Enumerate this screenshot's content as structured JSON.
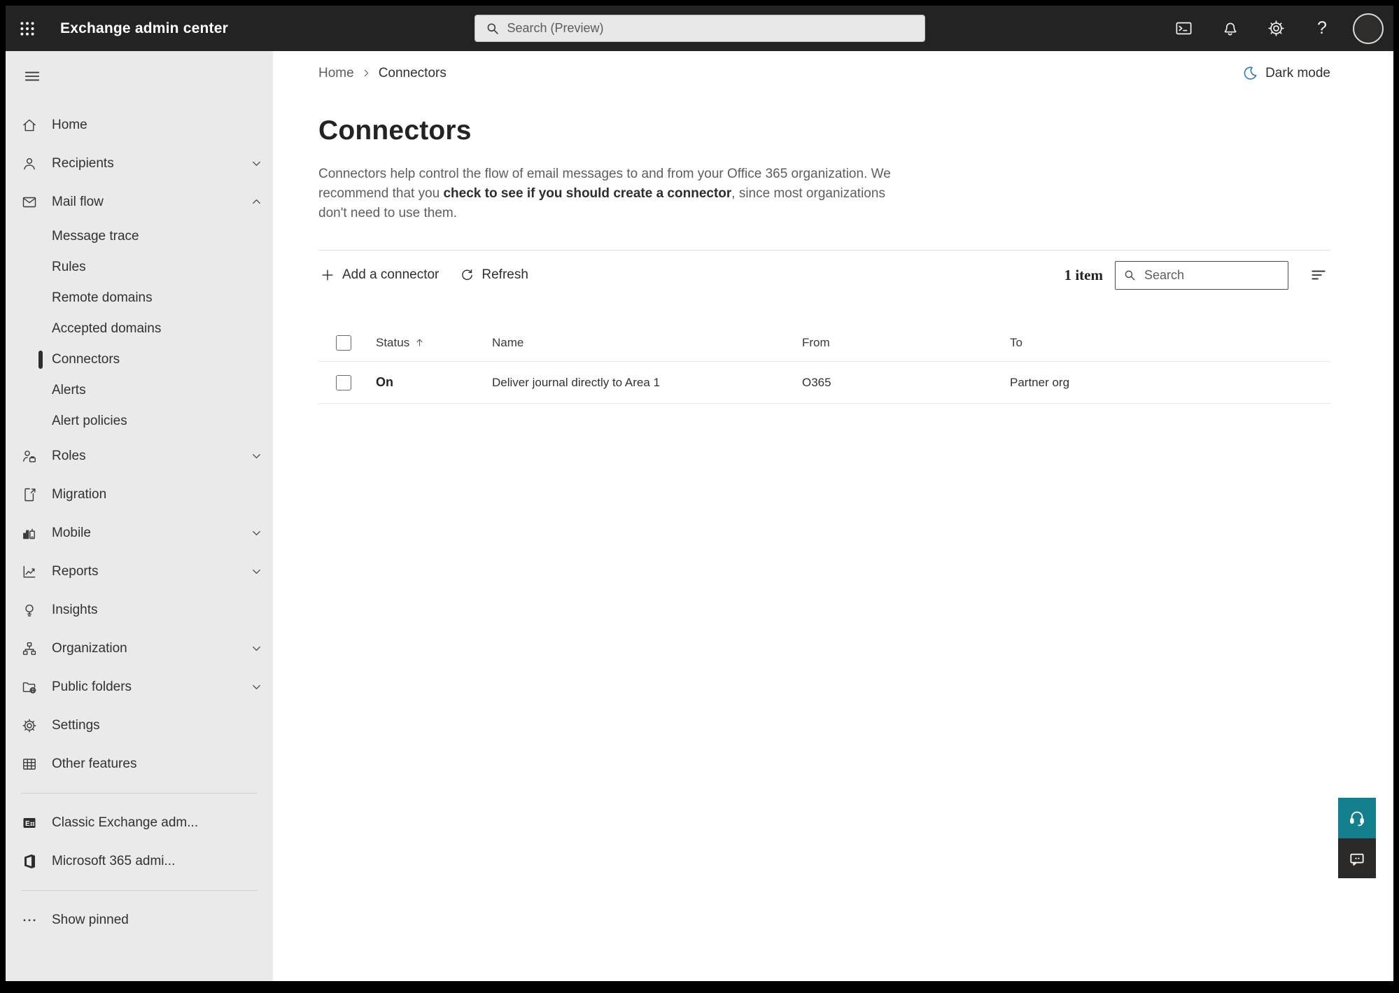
{
  "topbar": {
    "app_title": "Exchange admin center",
    "search_placeholder": "Search (Preview)",
    "help_glyph": "?"
  },
  "breadcrumb": {
    "home": "Home",
    "current": "Connectors"
  },
  "dark_mode": {
    "label": "Dark mode"
  },
  "page": {
    "title": "Connectors",
    "desc_pre": "Connectors help control the flow of email messages to and from your Office 365 organization. We recommend that you ",
    "desc_link": "check to see if you should create a connector",
    "desc_post": ", since most organizations don't need to use them."
  },
  "toolbar": {
    "add_label": "Add a connector",
    "refresh_label": "Refresh",
    "item_count": "1 item",
    "search_placeholder": "Search"
  },
  "table": {
    "sort_column": "Status",
    "sort_direction": "ascending",
    "columns": {
      "status": "Status",
      "name": "Name",
      "from": "From",
      "to": "To"
    },
    "rows": [
      {
        "status": "On",
        "name": "Deliver journal directly to Area 1",
        "from": "O365",
        "to": "Partner org"
      }
    ]
  },
  "sidebar": {
    "items": [
      {
        "label": "Home",
        "icon": "home-icon"
      },
      {
        "label": "Recipients",
        "icon": "person-icon",
        "expandable": true,
        "expanded": false
      },
      {
        "label": "Mail flow",
        "icon": "mail-icon",
        "expandable": true,
        "expanded": true
      },
      {
        "label": "Message trace",
        "sub": true
      },
      {
        "label": "Rules",
        "sub": true
      },
      {
        "label": "Remote domains",
        "sub": true
      },
      {
        "label": "Accepted domains",
        "sub": true
      },
      {
        "label": "Connectors",
        "sub": true,
        "selected": true
      },
      {
        "label": "Alerts",
        "sub": true
      },
      {
        "label": "Alert policies",
        "sub": true
      },
      {
        "label": "Roles",
        "icon": "roles-icon",
        "expandable": true,
        "expanded": false
      },
      {
        "label": "Migration",
        "icon": "migration-icon"
      },
      {
        "label": "Mobile",
        "icon": "mobile-icon",
        "expandable": true,
        "expanded": false
      },
      {
        "label": "Reports",
        "icon": "reports-icon",
        "expandable": true,
        "expanded": false
      },
      {
        "label": "Insights",
        "icon": "insights-icon"
      },
      {
        "label": "Organization",
        "icon": "organization-icon",
        "expandable": true,
        "expanded": false
      },
      {
        "label": "Public folders",
        "icon": "public-folders-icon",
        "expandable": true,
        "expanded": false
      },
      {
        "label": "Settings",
        "icon": "settings-icon"
      },
      {
        "label": "Other features",
        "icon": "other-features-icon"
      },
      {
        "label": "Classic Exchange adm...",
        "icon": "exchange-classic-icon"
      },
      {
        "label": "Microsoft 365 admi...",
        "icon": "microsoft-365-icon"
      },
      {
        "label": "Show pinned",
        "icon": "ellipsis-icon"
      }
    ]
  },
  "colors": {
    "topbar_bg": "#242323",
    "sidebar_bg": "#eaeaea",
    "accent_teal": "#15808d",
    "feedback_dark": "#2b2a29",
    "moon_blue": "#2d7ac6",
    "text_primary": "#323130",
    "text_secondary": "#605e5c"
  }
}
